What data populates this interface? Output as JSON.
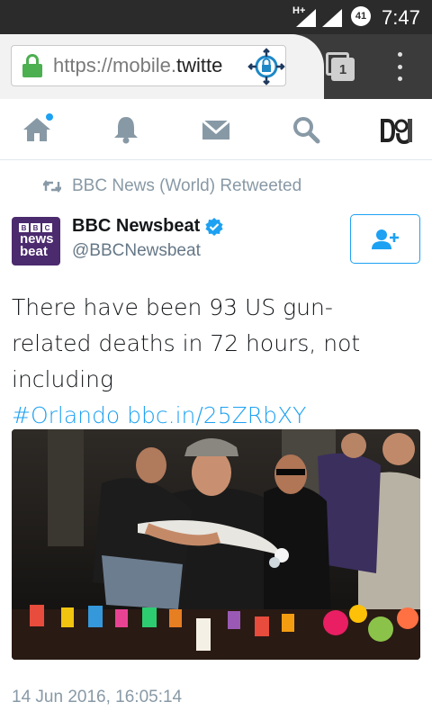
{
  "status_bar": {
    "network": "H+",
    "battery": "41",
    "time": "7:47"
  },
  "browser": {
    "url_scheme": "https://mobile.",
    "url_host": "twitte",
    "tab_count": "1"
  },
  "nav": {
    "items": [
      {
        "name": "home-icon"
      },
      {
        "name": "bell-icon"
      },
      {
        "name": "mail-icon"
      },
      {
        "name": "search-icon"
      }
    ],
    "accent": "#1da1f2"
  },
  "tweet": {
    "retweeted_by": "BBC News (World) Retweeted",
    "author_name": "BBC Newsbeat",
    "author_handle": "@BBCNewsbeat",
    "avatar": {
      "logo_letters": [
        "B",
        "B",
        "C"
      ],
      "line1": "news",
      "line2": "beat"
    },
    "text_plain": "There have been 93 US gun-related deaths in 72 hours, not including",
    "hashtag": "#Orlando",
    "link": "bbc.in/25ZRbXY",
    "timestamp": "14 Jun 2016, 16:05:14"
  },
  "colors": {
    "twitter_blue": "#1da1f2",
    "status_bar": "#2b2b2b",
    "browser_toolbar": "#3b3b3b",
    "avatar_purple": "#4b2a6e",
    "secure_green": "#4caf50"
  }
}
